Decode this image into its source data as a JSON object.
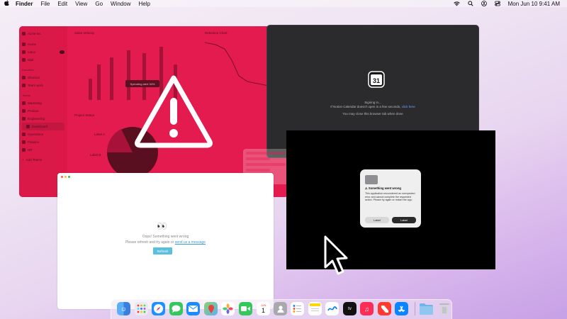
{
  "menubar": {
    "app": "Finder",
    "items": [
      "File",
      "Edit",
      "View",
      "Go",
      "Window",
      "Help"
    ],
    "clock": "Mon Jun 10  9:41 AM"
  },
  "red_window": {
    "sidebar": {
      "top": [
        {
          "label": "Acme Inc"
        },
        {
          "label": "Home"
        },
        {
          "label": "Inbox",
          "badge": ""
        },
        {
          "label": "Mail"
        }
      ],
      "favorites_header": "Favorites",
      "favorites": [
        "Shortcut",
        "Team work"
      ],
      "teams_header": "Teams",
      "teams": [
        "Marketing",
        "Product",
        "Engineering",
        "Dashboard",
        "Operations",
        "Finance",
        "HR",
        "Add Teams"
      ]
    },
    "chart1_title": "Sales Velocity",
    "chart2_title": "Retention Chart",
    "section_title": "Project Status",
    "tooltip": "Spending alert 34%",
    "pie_labels": [
      "Label A",
      "Label B"
    ]
  },
  "dark_window": {
    "icon": "calendar-icon",
    "icon_day": "31",
    "line1": "Signing in...",
    "line2_prefix": "If Notion Calendar doesn't open in a few seconds,",
    "line2_link": "click here",
    "line3": "You may close this browser tab when done"
  },
  "alert": {
    "icon": "folder-icon",
    "title": "Something went wrong",
    "body": "This application encountered an unexpected error and cannot complete the requested action. Please try again or restart the app.",
    "button_left": "Label",
    "button_right": "Label"
  },
  "white_window": {
    "emoji": "👀",
    "line1": "Oops! Something went wrong",
    "line2_prefix": "Please refresh and try again or",
    "line2_link": "send us a message",
    "refresh_label": "Refresh"
  },
  "colors": {
    "accent_red": "#e31b4e",
    "dark_window": "#2b2b2d",
    "link_blue": "#6aa6ff",
    "refresh_button": "#5bc0de"
  },
  "dock": {
    "apps": [
      "Finder",
      "Launchpad",
      "Safari",
      "Messages",
      "Mail",
      "Maps",
      "Photos",
      "FaceTime",
      "Calendar",
      "Contacts",
      "Reminders",
      "Notes",
      "Freeform",
      "Apple TV",
      "Music",
      "News",
      "App Store",
      "Downloads",
      "Trash"
    ],
    "calendar_day": "1",
    "calendar_month": "JUN"
  }
}
